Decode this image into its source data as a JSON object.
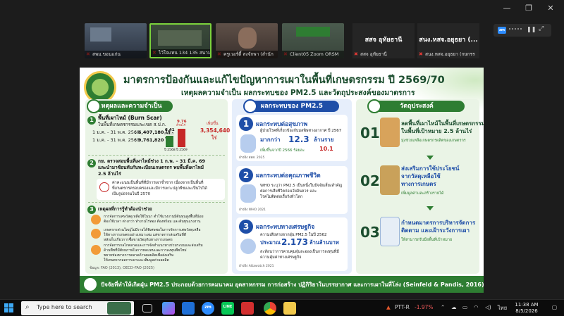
{
  "window": {
    "minimize": "—",
    "maximize": "❐",
    "close": "✕"
  },
  "participants": [
    {
      "name": "สพม.ขอนแก่น"
    },
    {
      "name": "ไว้ใจแทน 134 135 สนาม"
    },
    {
      "name": "ครูเวอร์ตี้ สงจักพา (สำนัก"
    },
    {
      "name": "Client05 Zoom ORSM"
    },
    {
      "title": "สสจ อุทัยธานี",
      "name": "สสจ อุทัยธานี"
    },
    {
      "title": "สนง.หสจ.อยุธยา (...",
      "name": "สนง.หสจ.อยุธยา (กษกรร"
    }
  ],
  "zoombar": {
    "logo": "zm"
  },
  "slide": {
    "title": "มาตรการป้องกันและแก้ไขปัญหาการเผาในพื้นที่เกษตรกรรม ปี 2569/70",
    "subtitle": "เหตุผลความจำเป็น ผลกระทบของ PM2.5 และวัตถุประสงค์ของมาตรการ",
    "col1": {
      "header": "เหตุผลและความจำเป็น",
      "s1_title": "พื้นที่เผาไหม้ (Burn Scar)",
      "s1_sub": "ในพื้นที่เกษตรกรรมและเขต ส.ป.ก.",
      "row1_label": "1 ม.ค. - 31 พ.ค. 2568",
      "row1_val": ": 6,407,180 ไร่",
      "row2_label": "1 ม.ค. - 31 พ.ค. 2569",
      "row2_val": ": 9,761,820 ไร่",
      "bar1_val": "6.41",
      "bar1_unit": "ล้านไร่",
      "bar2_val": "9.76",
      "bar2_unit": "ล้านไร่",
      "bar1_year": "ปี 2568",
      "bar2_year": "ปี 2569",
      "increase_label": "เพิ่มขึ้น",
      "increase_val": "3,354,640",
      "increase_unit": "ไร่",
      "s2_line1": "กษ. ตรวจสอบพื้นที่เผาไหม้ช่วง 1 ก.พ. – 31 มี.ค. 69",
      "s2_line2": "และนำมาซ้อนทับกับทะเบียนเกษตรกร พบพื้นที่เผาไหม้",
      "s2_line3": "2.5 ล้านไร่",
      "s2_note1": "ค่าคะแนนเป็นพื้นที่ที่มีการเผาซ้ำซาก เนื่องจากเป็นพื้นที่",
      "s2_note2": "ที่เกษตรกรครอบครองและมีการเพาะปลูกพืชและเป็นไปได้",
      "s2_note3": "เป็นรูปธรรมในปี 2570",
      "s3_title": "เหตุผลที่การรู้ทำต้องนำช่วย",
      "s3_a1": "การจัดการเศษวัสดุเหลือใช้ในนา ต่ำใช้แรงงานมีต้นทุนสูงพื้นที่น้อย",
      "s3_a2": "ต้องใช้เวลา ต่างกว่า ทำงานไร่ทอง ต้องพร้อม และต้นทุนแรงงาน",
      "s3_b1": "เกษตรกรส่วนใหญ่ไม่มีรายได้พิเศษพอในการจัดการเศษวัสดุเหลือ",
      "s3_b2": "ใช้ทางการเกษตรอย่างเหมาะสม แต่ขาดการส่งเสริมที่ดี",
      "s3_b3": "หลังเก็บเกี่ยวการซื้อขายวัตถุดิบทางการเกษตร",
      "s3_c1": "การจัดการกลไกตลาดและการจัดทำแนวทางร่วมระบบและส่งเสริม",
      "s3_c2": "ด้านพืชที่มีศักยภาพในการทดแทนและการลงทุนพืชใหม่",
      "s3_c3": "ขยายช่องทางการตลาดด้านผลผลิตเพื่อส่งเสริม",
      "s3_c4": "ให้เกษตรกรลดการเผาและเพิ่มมูลค่าผลผลิต",
      "source": "ข้อมูล: FAO (2013), OECD–FAO (2025)"
    },
    "col2": {
      "header": "ผลกระทบของ PM2.5",
      "c1_title": "ผลกระทบต่อสุขภาพ",
      "c1_line1": "ผู้ป่วยโรคที่เกี่ยวข้องกับมลพิษทางอากาศ ปี 2567",
      "c1_big_pre": "มากกว่า",
      "c1_big_val": "12.3",
      "c1_big_unit": "ล้านราย",
      "c1_line2": "เพิ่มขึ้นจากปี 2566 ร้อยละ",
      "c1_pct": "10.1",
      "c1_src": "อ้างอิง สสส. 2025",
      "c2_title": "ผลกระทบต่อคุณภาพชีวิต",
      "c2_line1": "WHO ระบุว่า PM2.5 เป็นหนึ่งในปัจจัยเสี่ยงสำคัญ",
      "c2_line2": "ต่อการเสียชีวิตก่อนวัยอันควร และ",
      "c2_line3": "โรคไม่ติดต่อเรื้อรังทั่วโลก",
      "c2_src": "อ้างอิง WHO 2021",
      "c3_title": "ผลกระทบทางเศรษฐกิจ",
      "c3_line1": "ความเสียหายจากฝุ่น PM2.5 ในปี 2562",
      "c3_pre": "ประมาณ",
      "c3_val": "2.173",
      "c3_unit": "ล้านล้านบาท",
      "c3_line2": "สะท้อนว่าการควบคุมฝุ่นละอองเป็นการลงทุนที่มี",
      "c3_line3": "ความคุ้มค่าทางเศรษฐกิจ",
      "c3_src": "อ้างอิง Attawatch 2021"
    },
    "col3": {
      "header": "วัตถุประสงค์",
      "o1_num": "01",
      "o1_line1": "ลดพื้นที่เผาไหม้ในพื้นที่เกษตรกรรม",
      "o1_line2": "ในพื้นที่เป้าหมาย 2.5 ล้านไร่",
      "o1_note": "มุ่งช่วยเหลือเกษตรกรผลิตของเกษตรกร",
      "o2_num": "02",
      "o2_line1": "ส่งเสริมการใช้ประโยชน์",
      "o2_line2": "จากวัสดุเหลือใช้",
      "o2_line3": "ทางการเกษตร",
      "o2_note": "เพิ่มมูลค่าและสร้างรายได้",
      "o3_num": "03",
      "o3_line1": "กำหนดมาตรการบริหารจัดการ",
      "o3_line2": "ติดตาม และเฝ้าระวังการเผา",
      "o3_note": "ให้สามารถรับมือพื้นที่เป้าหมาย"
    },
    "footer": "ปัจจัยที่ทำให้เกิดฝุ่น PM2.5 ประกอบด้วยการคมนาคม อุตสาหกรรม การก่อสร้าง ปฏิกิริยาในบรรยากาศ และการเผาในที่โล่ง (Seinfeld & Pandis, 2016)"
  },
  "taskbar": {
    "search_placeholder": "Type here to search",
    "zoom_label": "zm",
    "line_label": "LINE",
    "ticker": "PTT-R",
    "ticker_change": "-1.97%",
    "lang": "ไทย",
    "time": "11:38 AM",
    "date": "8/5/2026"
  }
}
